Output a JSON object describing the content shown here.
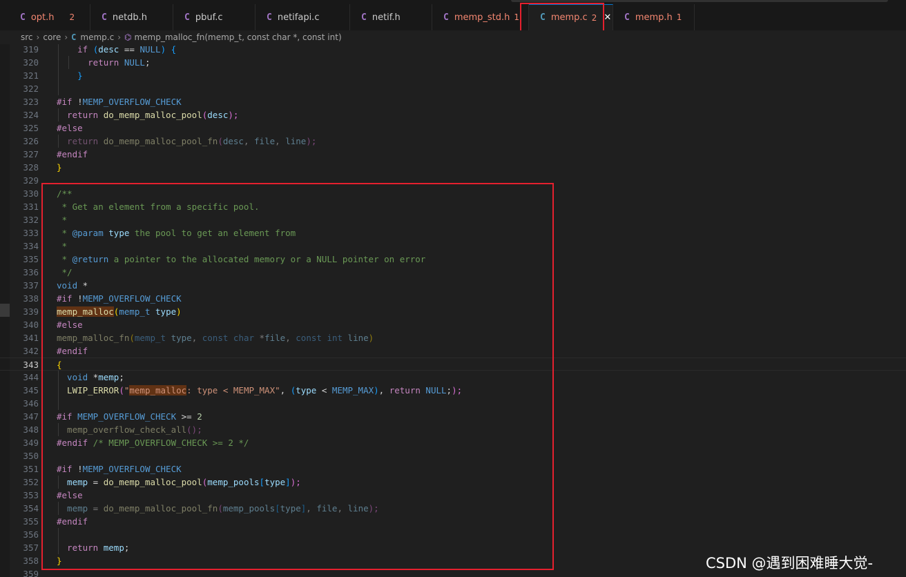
{
  "tabs": [
    {
      "name": "opt.h",
      "icon": "c-file-icon",
      "count": "2",
      "nameColor": "err"
    },
    {
      "name": "netdb.h",
      "icon": "c-file-icon",
      "count": "",
      "nameColor": "normal"
    },
    {
      "name": "pbuf.c",
      "icon": "c-file-icon",
      "count": "",
      "nameColor": "normal"
    },
    {
      "name": "netifapi.c",
      "icon": "c-file-icon",
      "count": "",
      "nameColor": "normal"
    },
    {
      "name": "netif.h",
      "icon": "c-file-icon",
      "count": "",
      "nameColor": "normal"
    },
    {
      "name": "memp_std.h",
      "icon": "c-file-icon",
      "count": "1",
      "nameColor": "err"
    },
    {
      "name": "memp.c",
      "icon": "c-file-icon",
      "count": "2",
      "nameColor": "err",
      "active": true,
      "close": "✕"
    },
    {
      "name": "memp.h",
      "icon": "c-file-icon",
      "count": "1",
      "nameColor": "err"
    }
  ],
  "breadcrumb": {
    "parts": [
      "src",
      "core",
      "memp.c",
      "memp_malloc_fn(memp_t, const char *, const int)"
    ]
  },
  "file_icon_letter": "C",
  "editor": {
    "current_line": "343",
    "lines": [
      {
        "n": "319",
        "g": 1,
        "t": [
          [
            "    ",
            "plain"
          ],
          [
            "if",
            "kw"
          ],
          [
            " (",
            "brk3"
          ],
          [
            "desc",
            "var"
          ],
          [
            " == ",
            "plain"
          ],
          [
            "NULL",
            "macro"
          ],
          [
            ") ",
            "brk3"
          ],
          [
            "{",
            "brk3"
          ]
        ]
      },
      {
        "n": "320",
        "g": 2,
        "t": [
          [
            "      ",
            "plain"
          ],
          [
            "return",
            "kw"
          ],
          [
            " ",
            "plain"
          ],
          [
            "NULL",
            "macro"
          ],
          [
            ";",
            "plain"
          ]
        ]
      },
      {
        "n": "321",
        "g": 1,
        "t": [
          [
            "    ",
            "plain"
          ],
          [
            "}",
            "brk3"
          ]
        ]
      },
      {
        "n": "322",
        "g": 1,
        "t": []
      },
      {
        "n": "323",
        "g": 0,
        "t": [
          [
            "#if",
            "kw"
          ],
          [
            " !",
            "plain"
          ],
          [
            "MEMP_OVERFLOW_CHECK",
            "macro"
          ]
        ]
      },
      {
        "n": "324",
        "g": 1,
        "t": [
          [
            "  return",
            "kw"
          ],
          [
            " ",
            "plain"
          ],
          [
            "do_memp_malloc_pool",
            "fn"
          ],
          [
            "(",
            "brk2"
          ],
          [
            "desc",
            "var"
          ],
          [
            ");",
            "brk2"
          ]
        ]
      },
      {
        "n": "325",
        "g": 0,
        "t": [
          [
            "#else",
            "kw"
          ]
        ]
      },
      {
        "n": "326",
        "g": 1,
        "dim": true,
        "t": [
          [
            "  return",
            "kw"
          ],
          [
            " ",
            "plain"
          ],
          [
            "do_memp_malloc_pool_fn",
            "fn"
          ],
          [
            "(",
            "brk2"
          ],
          [
            "desc",
            "var"
          ],
          [
            ", ",
            "plain"
          ],
          [
            "file",
            "var"
          ],
          [
            ", ",
            "plain"
          ],
          [
            "line",
            "var"
          ],
          [
            ");",
            "brk2"
          ]
        ]
      },
      {
        "n": "327",
        "g": 0,
        "t": [
          [
            "#endif",
            "kw"
          ]
        ]
      },
      {
        "n": "328",
        "g": 0,
        "t": [
          [
            "}",
            "brk"
          ]
        ]
      },
      {
        "n": "329",
        "g": 0,
        "t": []
      },
      {
        "n": "330",
        "g": 0,
        "t": [
          [
            "/**",
            "comment"
          ]
        ]
      },
      {
        "n": "331",
        "g": 0,
        "t": [
          [
            " * Get an element from a specific pool.",
            "comment"
          ]
        ]
      },
      {
        "n": "332",
        "g": 0,
        "t": [
          [
            " *",
            "comment"
          ]
        ]
      },
      {
        "n": "333",
        "g": 0,
        "t": [
          [
            " * ",
            "comment"
          ],
          [
            "@param",
            "doctag"
          ],
          [
            " ",
            "comment"
          ],
          [
            "type",
            "docparam"
          ],
          [
            " the pool to get an element from",
            "comment"
          ]
        ]
      },
      {
        "n": "334",
        "g": 0,
        "t": [
          [
            " *",
            "comment"
          ]
        ]
      },
      {
        "n": "335",
        "g": 0,
        "t": [
          [
            " * ",
            "comment"
          ],
          [
            "@return",
            "doctag"
          ],
          [
            " a pointer to the allocated memory or a NULL pointer on error",
            "comment"
          ]
        ]
      },
      {
        "n": "336",
        "g": 0,
        "t": [
          [
            " */",
            "comment"
          ]
        ]
      },
      {
        "n": "337",
        "g": 0,
        "t": [
          [
            "void",
            "type"
          ],
          [
            " *",
            "plain"
          ]
        ]
      },
      {
        "n": "338",
        "g": 0,
        "t": [
          [
            "#if",
            "kw"
          ],
          [
            " !",
            "plain"
          ],
          [
            "MEMP_OVERFLOW_CHECK",
            "macro"
          ]
        ]
      },
      {
        "n": "339",
        "g": 0,
        "t": [
          [
            "memp_malloc",
            "fnhl"
          ],
          [
            "(",
            "brk"
          ],
          [
            "memp_t",
            "type"
          ],
          [
            " ",
            "plain"
          ],
          [
            "type",
            "var"
          ],
          [
            ")",
            "brk"
          ]
        ]
      },
      {
        "n": "340",
        "g": 0,
        "t": [
          [
            "#else",
            "kw"
          ]
        ]
      },
      {
        "n": "341",
        "g": 0,
        "dim": true,
        "t": [
          [
            "memp_malloc_fn",
            "fn"
          ],
          [
            "(",
            "brk"
          ],
          [
            "memp_t",
            "type"
          ],
          [
            " ",
            "plain"
          ],
          [
            "type",
            "var"
          ],
          [
            ", ",
            "plain"
          ],
          [
            "const",
            "type"
          ],
          [
            " ",
            "plain"
          ],
          [
            "char",
            "type"
          ],
          [
            " *",
            "plain"
          ],
          [
            "file",
            "var"
          ],
          [
            ", ",
            "plain"
          ],
          [
            "const",
            "type"
          ],
          [
            " ",
            "plain"
          ],
          [
            "int",
            "type"
          ],
          [
            " ",
            "plain"
          ],
          [
            "line",
            "var"
          ],
          [
            ")",
            "brk"
          ]
        ]
      },
      {
        "n": "342",
        "g": 0,
        "t": [
          [
            "#endif",
            "kw"
          ]
        ]
      },
      {
        "n": "343",
        "g": 0,
        "t": [
          [
            "{",
            "brk"
          ]
        ]
      },
      {
        "n": "344",
        "g": 1,
        "t": [
          [
            "  void",
            "type"
          ],
          [
            " *",
            "plain"
          ],
          [
            "memp",
            "var"
          ],
          [
            ";",
            "plain"
          ]
        ]
      },
      {
        "n": "345",
        "g": 1,
        "t": [
          [
            "  LWIP_ERROR",
            "fn"
          ],
          [
            "(",
            "brk2"
          ],
          [
            "\"",
            "str"
          ],
          [
            "memp_malloc",
            "strhl"
          ],
          [
            ": type < MEMP_MAX\"",
            "str"
          ],
          [
            ", ",
            "plain"
          ],
          [
            "(",
            "brk3"
          ],
          [
            "type",
            "var"
          ],
          [
            " < ",
            "plain"
          ],
          [
            "MEMP_MAX",
            "macro"
          ],
          [
            ")",
            "brk3"
          ],
          [
            ", ",
            "plain"
          ],
          [
            "return",
            "kw"
          ],
          [
            " ",
            "plain"
          ],
          [
            "NULL",
            "macro"
          ],
          [
            ";",
            "plain"
          ],
          [
            ");",
            "brk2"
          ]
        ]
      },
      {
        "n": "346",
        "g": 1,
        "t": []
      },
      {
        "n": "347",
        "g": 0,
        "t": [
          [
            "#if",
            "kw"
          ],
          [
            " ",
            "plain"
          ],
          [
            "MEMP_OVERFLOW_CHECK",
            "macro"
          ],
          [
            " >= ",
            "plain"
          ],
          [
            "2",
            "num"
          ]
        ]
      },
      {
        "n": "348",
        "g": 1,
        "dim": true,
        "t": [
          [
            "  memp_overflow_check_all",
            "fn"
          ],
          [
            "();",
            "brk2"
          ]
        ]
      },
      {
        "n": "349",
        "g": 0,
        "t": [
          [
            "#endif",
            "kw"
          ],
          [
            " /* MEMP_OVERFLOW_CHECK >= 2 */",
            "comment"
          ]
        ]
      },
      {
        "n": "350",
        "g": 0,
        "t": []
      },
      {
        "n": "351",
        "g": 0,
        "t": [
          [
            "#if",
            "kw"
          ],
          [
            " !",
            "plain"
          ],
          [
            "MEMP_OVERFLOW_CHECK",
            "macro"
          ]
        ]
      },
      {
        "n": "352",
        "g": 1,
        "t": [
          [
            "  memp",
            "var"
          ],
          [
            " = ",
            "plain"
          ],
          [
            "do_memp_malloc_pool",
            "fn"
          ],
          [
            "(",
            "brk2"
          ],
          [
            "memp_pools",
            "var"
          ],
          [
            "[",
            "brk3"
          ],
          [
            "type",
            "var"
          ],
          [
            "]",
            "brk3"
          ],
          [
            ");",
            "brk2"
          ]
        ]
      },
      {
        "n": "353",
        "g": 0,
        "t": [
          [
            "#else",
            "kw"
          ]
        ]
      },
      {
        "n": "354",
        "g": 1,
        "dim": true,
        "t": [
          [
            "  memp",
            "var"
          ],
          [
            " = ",
            "plain"
          ],
          [
            "do_memp_malloc_pool_fn",
            "fn"
          ],
          [
            "(",
            "brk2"
          ],
          [
            "memp_pools",
            "var"
          ],
          [
            "[",
            "brk3"
          ],
          [
            "type",
            "var"
          ],
          [
            "]",
            "brk3"
          ],
          [
            ", ",
            "plain"
          ],
          [
            "file",
            "var"
          ],
          [
            ", ",
            "plain"
          ],
          [
            "line",
            "var"
          ],
          [
            ");",
            "brk2"
          ]
        ]
      },
      {
        "n": "355",
        "g": 0,
        "t": [
          [
            "#endif",
            "kw"
          ]
        ]
      },
      {
        "n": "356",
        "g": 1,
        "t": []
      },
      {
        "n": "357",
        "g": 1,
        "t": [
          [
            "  return",
            "kw"
          ],
          [
            " ",
            "plain"
          ],
          [
            "memp",
            "var"
          ],
          [
            ";",
            "plain"
          ]
        ]
      },
      {
        "n": "358",
        "g": 0,
        "t": [
          [
            "}",
            "brk"
          ]
        ]
      },
      {
        "n": "359",
        "g": 0,
        "t": []
      }
    ]
  },
  "watermark": "CSDN @遇到困难睡大觉-"
}
